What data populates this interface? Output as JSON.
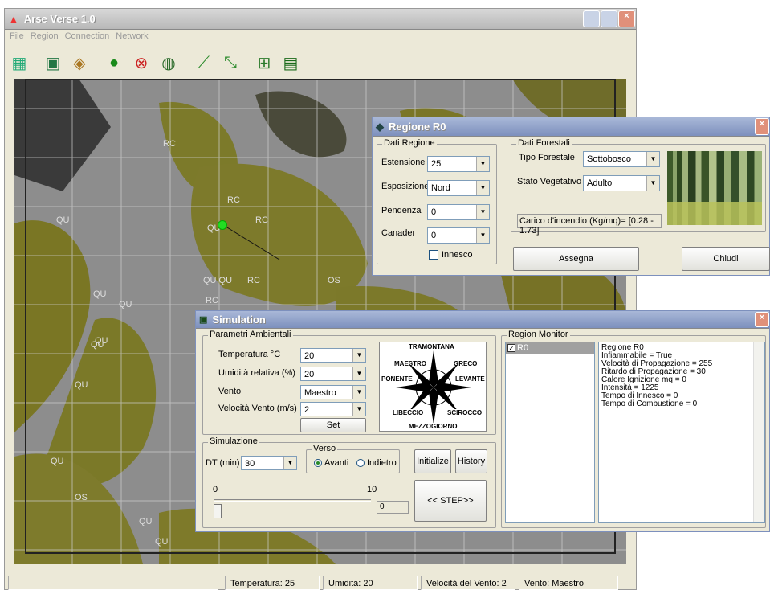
{
  "app": {
    "title": "Arse Verse 1.0",
    "menu": [
      "File",
      "Region",
      "Connection",
      "Network"
    ]
  },
  "map": {
    "labels": [
      "QU",
      "QU",
      "QU",
      "RC",
      "RC",
      "QU",
      "RC",
      "RC",
      "QU QU",
      "RC",
      "OS",
      "QU",
      "QU",
      "QU",
      "QU",
      "OS",
      "QU",
      "QU"
    ]
  },
  "regione": {
    "title": "Regione R0",
    "dati_regione": {
      "legend": "Dati Regione",
      "estensione_label": "Estensione",
      "estensione": "25",
      "esposizione_label": "Esposizione",
      "esposizione": "Nord",
      "pendenza_label": "Pendenza",
      "pendenza": "0",
      "canader_label": "Canader",
      "canader": "0",
      "innesco_label": "Innesco"
    },
    "dati_forestali": {
      "legend": "Dati Forestali",
      "tipo_label": "Tipo Forestale",
      "tipo": "Sottobosco",
      "stato_label": "Stato Vegetativo",
      "stato": "Adulto",
      "carico": "Carico d'incendio (Kg/mq)= [0.28 - 1.73]"
    },
    "assegna": "Assegna",
    "chiudi": "Chiudi"
  },
  "simulation": {
    "title": "Simulation",
    "parametri": {
      "legend": "Parametri Ambientali",
      "temp_label": "Temperatura °C",
      "temp": "20",
      "umid_label": "Umidità relativa (%)",
      "umid": "20",
      "vento_label": "Vento",
      "vento": "Maestro",
      "vel_label": "Velocità Vento (m/s)",
      "vel": "2",
      "set": "Set"
    },
    "compass": {
      "n": "TRAMONTANA",
      "nw": "MAESTRO",
      "ne": "GRECO",
      "w": "PONENTE",
      "e": "LEVANTE",
      "sw": "LIBECCIO",
      "se": "SCIROCCO",
      "s": "MEZZOGIORNO"
    },
    "sim": {
      "legend": "Simulazione",
      "dt_label": "DT (min)",
      "dt": "30",
      "verso_legend": "Verso",
      "avanti": "Avanti",
      "indietro": "Indietro",
      "initialize": "Initialize",
      "history": "History",
      "slider_min": "0",
      "slider_max": "10",
      "slider_value": "0",
      "step": "<< STEP>>"
    },
    "monitor": {
      "legend": "Region Monitor",
      "item": "R0",
      "details": [
        "Regione R0",
        "Infiammabile = True",
        "Velocità di Propagazione = 255",
        "Ritardo di Propagazione = 30",
        "Calore Ignizione mq = 0",
        "Intensità = 1225",
        "Tempo di Innesco = 0",
        "Tempo di Combustione = 0"
      ]
    }
  },
  "status": {
    "temp": "Temperatura: 25",
    "umid": "Umidità: 20",
    "vel": "Velocità del Vento: 2",
    "vento": "Vento: Maestro"
  }
}
